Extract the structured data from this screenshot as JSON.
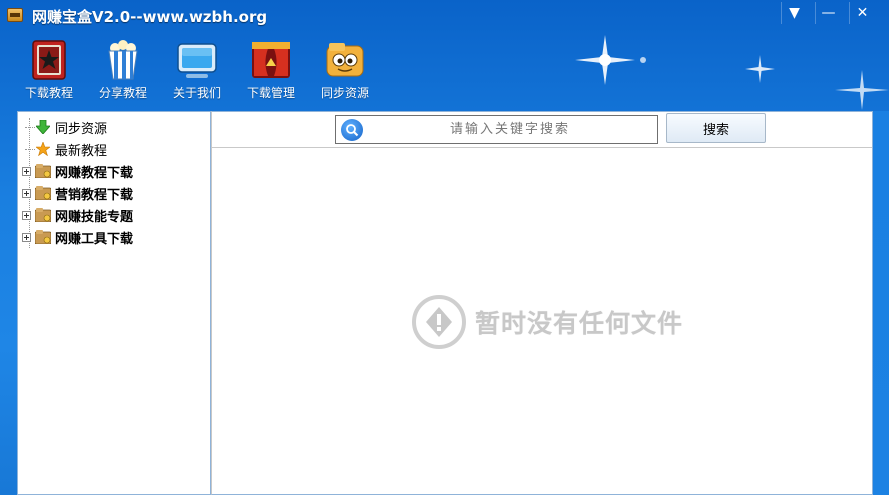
{
  "window": {
    "title": "网赚宝盒V2.0--www.wzbh.org",
    "controls": {
      "menu": "▼",
      "minimize": "—",
      "close": "✕"
    }
  },
  "toolbar": {
    "items": [
      {
        "label": "下载教程",
        "icon": "book-star-icon"
      },
      {
        "label": "分享教程",
        "icon": "popcorn-icon"
      },
      {
        "label": "关于我们",
        "icon": "monitor-icon"
      },
      {
        "label": "下载管理",
        "icon": "stage-curtain-icon"
      },
      {
        "label": "同步资源",
        "icon": "smiley-folder-icon"
      }
    ]
  },
  "tree": {
    "items": [
      {
        "label": "同步资源",
        "icon": "green-down-arrow-icon",
        "expandable": false,
        "bold": false
      },
      {
        "label": "最新教程",
        "icon": "star-icon",
        "expandable": false,
        "bold": false
      },
      {
        "label": "网赚教程下载",
        "icon": "folder-icon",
        "expandable": true,
        "bold": true
      },
      {
        "label": "营销教程下载",
        "icon": "folder-icon",
        "expandable": true,
        "bold": true
      },
      {
        "label": "网赚技能专题",
        "icon": "folder-icon",
        "expandable": true,
        "bold": true
      },
      {
        "label": "网赚工具下载",
        "icon": "folder-icon",
        "expandable": true,
        "bold": true
      }
    ]
  },
  "search": {
    "placeholder": "请输入关键字搜索",
    "button_label": "搜索"
  },
  "empty_state": {
    "message": "暂时没有任何文件",
    "icon": "warning-circle-icon"
  },
  "colors": {
    "window_blue": "#1a7fe0",
    "panel_border": "#8fb3d9",
    "empty_text": "#c8c8c8"
  }
}
